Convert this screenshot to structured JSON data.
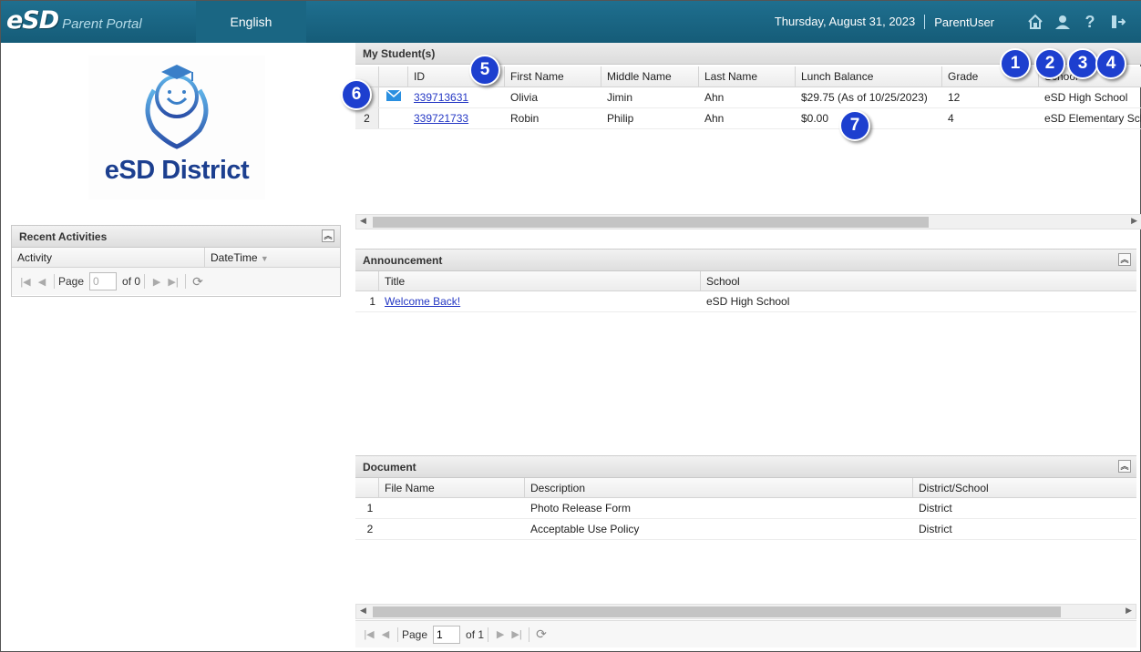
{
  "header": {
    "logo_mark": "eSD",
    "logo_sub": "Parent Portal",
    "language": "English",
    "date": "Thursday, August 31, 2023",
    "user": "ParentUser",
    "icons": [
      "home-icon",
      "user-icon",
      "help-icon",
      "logout-icon"
    ]
  },
  "district": {
    "name": "eSD District"
  },
  "recent": {
    "title": "Recent Activities",
    "columns": [
      "Activity",
      "DateTime"
    ],
    "pager": {
      "page_label": "Page",
      "page_value": "0",
      "of_label": "of 0"
    }
  },
  "students": {
    "title": "My Student(s)",
    "columns": [
      "",
      "",
      "ID",
      "First Name",
      "Middle Name",
      "Last Name",
      "Lunch Balance",
      "Grade",
      "School"
    ],
    "rows": [
      {
        "num": "1",
        "id": "339713631",
        "first": "Olivia",
        "middle": "Jimin",
        "last": "Ahn",
        "lunch": "$29.75 (As of 10/25/2023)",
        "grade": "12",
        "school": "eSD High School"
      },
      {
        "num": "2",
        "id": "339721733",
        "first": "Robin",
        "middle": "Philip",
        "last": "Ahn",
        "lunch": "$0.00",
        "grade": "4",
        "school": "eSD Elementary Sch"
      }
    ]
  },
  "announcement": {
    "title": "Announcement",
    "columns": [
      "Title",
      "School"
    ],
    "rows": [
      {
        "num": "1",
        "title": "Welcome Back!",
        "school": "eSD High School"
      }
    ]
  },
  "document": {
    "title": "Document",
    "columns": [
      "File Name",
      "Description",
      "District/School"
    ],
    "rows": [
      {
        "num": "1",
        "file": "",
        "description": "Photo Release Form",
        "scope": "District"
      },
      {
        "num": "2",
        "file": "",
        "description": "Acceptable Use Policy",
        "scope": "District"
      }
    ],
    "pager": {
      "page_label": "Page",
      "page_value": "1",
      "of_label": "of 1"
    }
  },
  "callouts": [
    "1",
    "2",
    "3",
    "4",
    "5",
    "6",
    "7"
  ]
}
